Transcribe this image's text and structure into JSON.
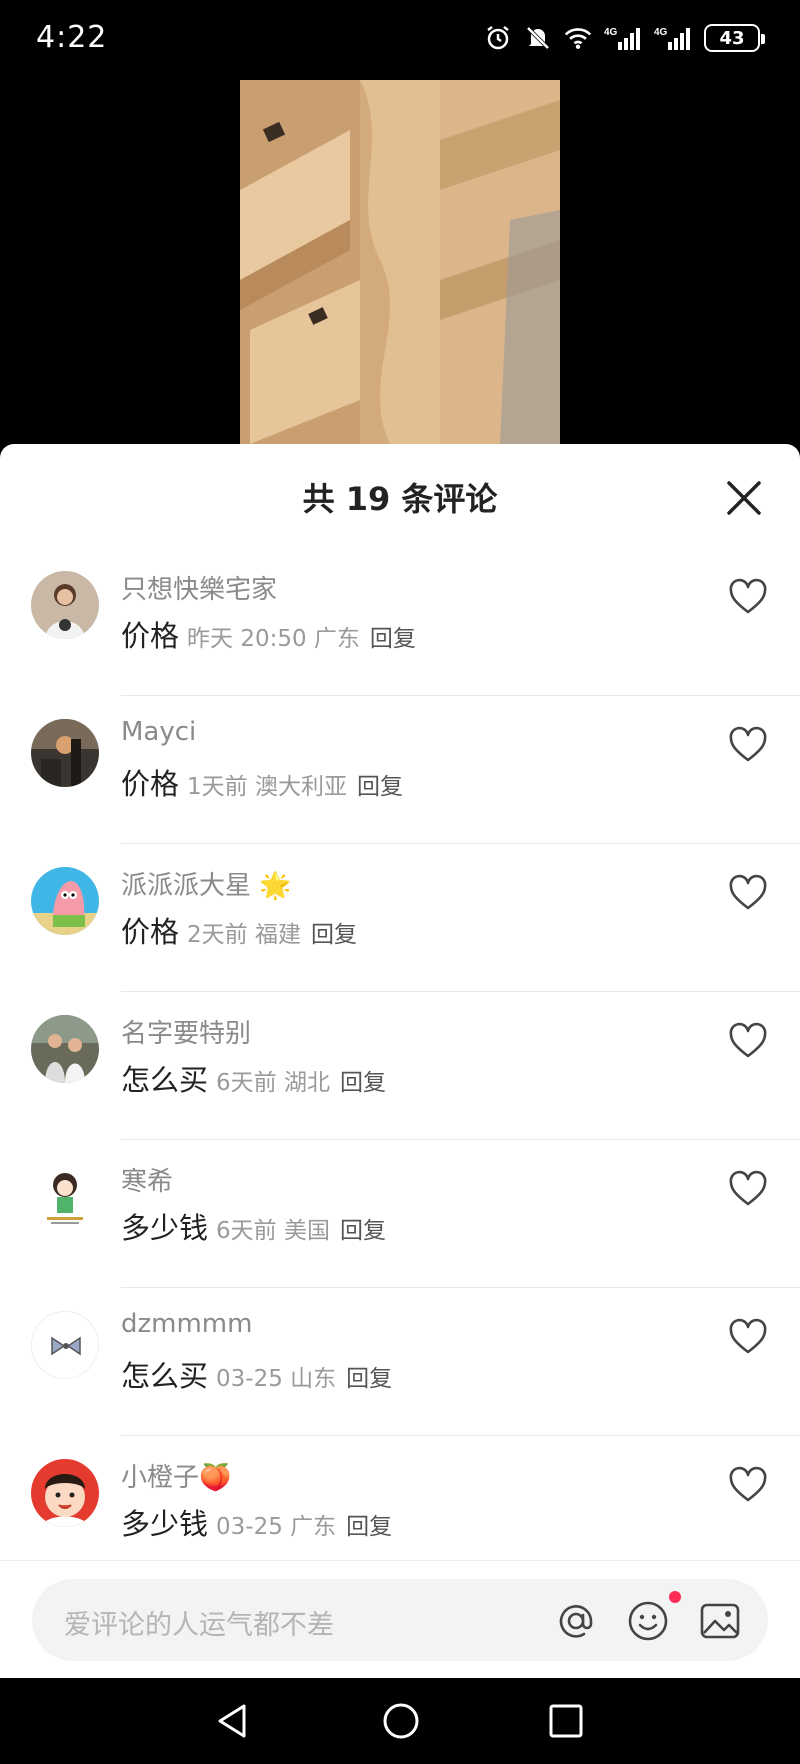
{
  "status_bar": {
    "time": "4:22",
    "icons": [
      "alarm-icon",
      "mute-icon",
      "wifi-icon",
      "signal-4g-icon",
      "signal-4g-icon"
    ],
    "signal_label_1": "4G",
    "signal_label_2": "4G",
    "battery": "43"
  },
  "panel": {
    "title": "共 19 条评论"
  },
  "comments": [
    {
      "user": "只想快樂宅家",
      "text": "价格",
      "meta": "昨天 20:50 广东",
      "reply": "回复"
    },
    {
      "user": "Mayci",
      "text": "价格",
      "meta": "1天前  澳大利亚",
      "reply": "回复"
    },
    {
      "user": "派派派大星",
      "emoji": "🌟",
      "text": "价格",
      "meta": "2天前  福建",
      "reply": "回复"
    },
    {
      "user": "名字要特别",
      "text": "怎么买",
      "meta": "6天前  湖北",
      "reply": "回复"
    },
    {
      "user": "寒希",
      "text": "多少钱",
      "meta": "6天前  美国",
      "reply": "回复"
    },
    {
      "user": "dzmmmm",
      "text": "怎么买",
      "meta": "03-25 山东",
      "reply": "回复"
    },
    {
      "user": "小橙子",
      "emoji": "🍑",
      "text": "多少钱",
      "meta": "03-25 广东",
      "reply": "回复"
    }
  ],
  "input": {
    "placeholder": "爱评论的人运气都不差",
    "icons": [
      "at-icon",
      "emoji-icon",
      "image-icon"
    ]
  },
  "nav": {
    "icons": [
      "back-icon",
      "home-icon",
      "recents-icon"
    ]
  },
  "colors": {
    "accent": "#ff2c55",
    "text_primary": "#222222",
    "text_secondary": "#9a9a9a"
  }
}
